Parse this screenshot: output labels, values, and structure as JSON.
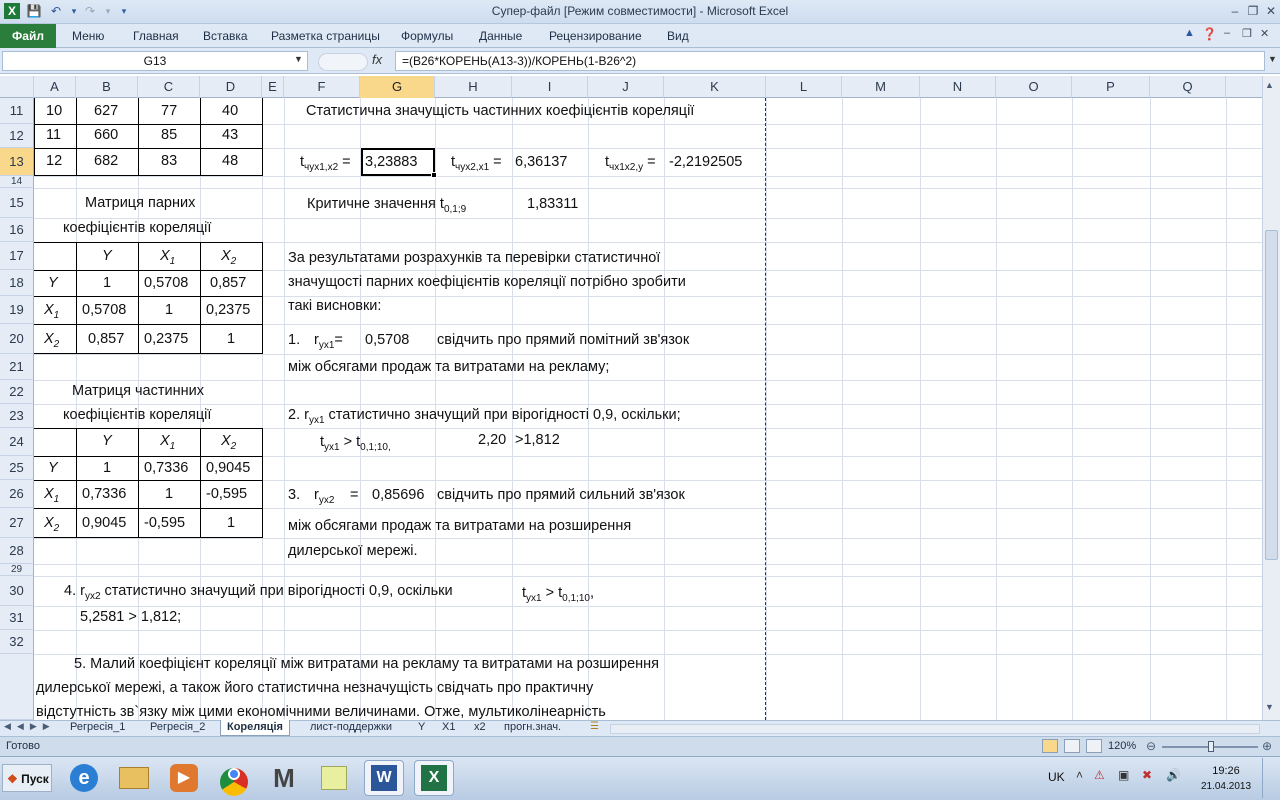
{
  "window": {
    "title": "Супер-файл  [Режим совместимости]  -  Microsoft Excel",
    "file_tab": "Файл",
    "tabs": [
      "Меню",
      "Главная",
      "Вставка",
      "Разметка страницы",
      "Формулы",
      "Данные",
      "Рецензирование",
      "Вид"
    ]
  },
  "formula_bar": {
    "name_box": "G13",
    "fx": "fx",
    "formula": "=(B26*КОРЕНЬ(A13-3))/КОРЕНЬ(1-B26^2)"
  },
  "columns": [
    "A",
    "B",
    "C",
    "D",
    "E",
    "F",
    "G",
    "H",
    "I",
    "J",
    "K",
    "L",
    "M",
    "N",
    "O",
    "P",
    "Q"
  ],
  "rows": [
    "11",
    "12",
    "13",
    "14",
    "15",
    "16",
    "17",
    "18",
    "19",
    "20",
    "21",
    "22",
    "23",
    "24",
    "25",
    "26",
    "27",
    "28",
    "29",
    "30",
    "31",
    "32"
  ],
  "data_table": [
    [
      "10",
      "627",
      "77",
      "40"
    ],
    [
      "11",
      "660",
      "85",
      "43"
    ],
    [
      "12",
      "682",
      "83",
      "48"
    ]
  ],
  "stat_title": "Статистична значущість частинних коефіцієнтів кореляції",
  "t_values": {
    "t1_label": "t",
    "t1_sub": "чух1,х2",
    "t1_val": "3,23883",
    "t2_label": "t",
    "t2_sub": "чух2,х1",
    "t2_val": "6,36137",
    "t3_label": "t",
    "t3_sub": "чх1х2,у",
    "t3_val": "-2,2192505"
  },
  "critical": {
    "label": "Критичне значення t",
    "sub": "0,1;9",
    "value": "1,83311"
  },
  "pair_matrix": {
    "title1": "Матриця парних",
    "title2": "коефіцієнтів кореляції",
    "headers": [
      "Y",
      "X",
      "X"
    ],
    "header_subs": [
      "",
      "1",
      "2"
    ],
    "rows": [
      {
        "label": "Y",
        "sub": "",
        "cells": [
          "1",
          "0,5708",
          "0,857"
        ]
      },
      {
        "label": "X",
        "sub": "1",
        "cells": [
          "0,5708",
          "1",
          "0,2375"
        ]
      },
      {
        "label": "X",
        "sub": "2",
        "cells": [
          "0,857",
          "0,2375",
          "1"
        ]
      }
    ]
  },
  "partial_matrix": {
    "title1": "Матриця частинних",
    "title2": "коефіцієнтів кореляції",
    "headers": [
      "Y",
      "X",
      "X"
    ],
    "header_subs": [
      "",
      "1",
      "2"
    ],
    "rows": [
      {
        "label": "Y",
        "sub": "",
        "cells": [
          "1",
          "0,7336",
          "0,9045"
        ]
      },
      {
        "label": "X",
        "sub": "1",
        "cells": [
          "0,7336",
          "1",
          "-0,595"
        ]
      },
      {
        "label": "X",
        "sub": "2",
        "cells": [
          "0,9045",
          "-0,595",
          "1"
        ]
      }
    ]
  },
  "text": {
    "p1": "За результатами розрахунків та перевірки статистичної",
    "p2": "значущості парних коефіцієнтів кореляції потрібно зробити",
    "p3": "такі висновки:",
    "i1_num": "1.",
    "i1_r": "r",
    "i1_sub": "ух1",
    "i1_eq": "=",
    "i1_val": "0,5708",
    "i1_text": "свідчить про прямий помітний зв'язок",
    "i1_line2": "між обсягами продаж та витратами на рекламу;",
    "i2_a": "2. r",
    "i2_sub": "ух1",
    "i2_b": " статистично значущий при вірогідності 0,9, оскільки;",
    "i2_t": "t",
    "i2_tsub": "ух1",
    "i2_gt": " > t",
    "i2_gtsub": "0,1;10,",
    "i2_val1": "2,20",
    "i2_val2": ">1,812",
    "i3_num": "3.",
    "i3_r": "r",
    "i3_sub": "ух2",
    "i3_eq": "=",
    "i3_val": "0,85696",
    "i3_text": "свідчить про прямий сильний зв'язок",
    "i3_line2": "між обсягами продаж та витратами на розширення",
    "i3_line3": "дилерської мережі.",
    "i4_a": "4. r",
    "i4_sub": "ух2",
    "i4_b": " статистично значущий при вірогідності 0,9, оскільки",
    "i4_t": "t",
    "i4_tsub": "ух1",
    "i4_gt": " > t",
    "i4_gtsub": "0,1;10",
    "i4_comma": ",",
    "i4_line2": "5,2581   >  1,812;",
    "i5_l1": "5. Малий коефіцієнт кореляції між витратами на рекламу та витратами на розширення",
    "i5_l2": "дилерської мережі, а також його статистична незначущість свідчать про практичну",
    "i5_l3": "відстутність зв`язку між цими економічними величинами. Отже, мультиколінеарність"
  },
  "sheet_tabs": [
    "Регресія_1",
    "Регресія_2",
    "Кореляція",
    "лист-поддержки",
    "Y",
    "X1",
    "x2",
    "прогн.знач."
  ],
  "active_sheet": "Кореляція",
  "status": {
    "ready": "Готово",
    "zoom": "120%"
  },
  "taskbar": {
    "start": "Пуск",
    "lang": "UK",
    "time": "19:26",
    "date": "21.04.2013"
  },
  "colors": {
    "file_tab": "#2a7d3a",
    "selected_header": "#f9d88b"
  }
}
